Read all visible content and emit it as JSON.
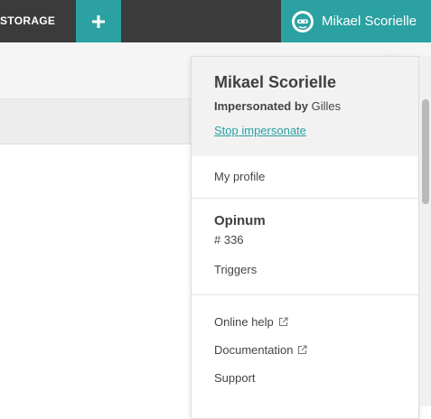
{
  "topbar": {
    "nav_storage_label": "STORAGE",
    "add_button_icon": "plus-icon",
    "user_name": "Mikael Scorielle",
    "accent_color": "#2ba1a1",
    "bar_color": "#3b3b3b"
  },
  "dropdown": {
    "name": "Mikael Scorielle",
    "impersonated_label": "Impersonated by",
    "impersonated_by": "Gilles",
    "stop_impersonate_label": "Stop impersonate",
    "my_profile_label": "My profile",
    "organization": {
      "name": "Opinum",
      "id": "# 336",
      "triggers_label": "Triggers"
    },
    "help": {
      "online_help_label": "Online help",
      "documentation_label": "Documentation",
      "support_label": "Support"
    }
  }
}
